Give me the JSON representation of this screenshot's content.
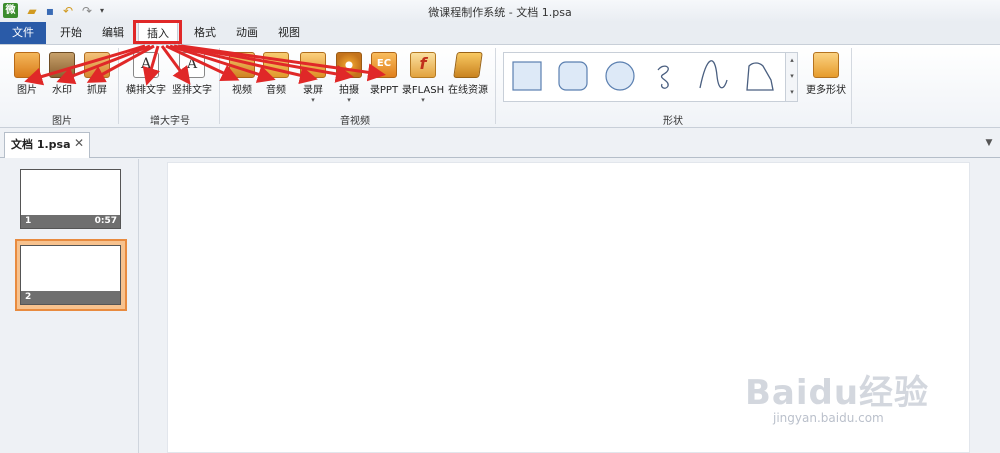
{
  "window": {
    "title": "微课程制作系统 - 文档 1.psa",
    "app_logo_glyph": "微",
    "quick_access": [
      "open-icon",
      "save-icon",
      "undo-icon",
      "redo-icon",
      "customize-icon"
    ]
  },
  "menu_tabs": [
    {
      "label": "文件",
      "active": false
    },
    {
      "label": "开始",
      "active": false
    },
    {
      "label": "编辑",
      "active": false
    },
    {
      "label": "插入",
      "active": true
    },
    {
      "label": "格式",
      "active": false
    },
    {
      "label": "动画",
      "active": false
    },
    {
      "label": "视图",
      "active": false
    }
  ],
  "ribbon": {
    "groups": [
      {
        "label": "图片",
        "buttons": [
          "图片",
          "水印",
          "抓屏"
        ]
      },
      {
        "label": "增大字号",
        "buttons": [
          "横排文字",
          "竖排文字"
        ]
      },
      {
        "label": "音视频",
        "buttons": [
          "视频",
          "音频",
          "录屏",
          "拍摄",
          "录PPT",
          "录FLASH",
          "在线资源"
        ]
      },
      {
        "label": "形状",
        "buttons": [
          "更多形状"
        ]
      }
    ],
    "txt_icon_glyph": "A",
    "ppt_icon_glyph": "EC",
    "flash_icon_glyph": "f",
    "dropdown_glyph": "▾",
    "gallery_scroll": [
      "▴",
      "▾",
      "▾"
    ]
  },
  "document_tab": {
    "label": "文档 1.psa",
    "close": "✕"
  },
  "strip_menu_glyph": "▼",
  "slides": [
    {
      "number": "1",
      "duration": "0:57",
      "selected": false
    },
    {
      "number": "2",
      "duration": "",
      "selected": true
    }
  ],
  "watermark": {
    "brand": "Baidu经验",
    "sub": "jingyan.baidu.com"
  },
  "colors": {
    "file_tab": "#2a5ba8",
    "highlight": "#e02828",
    "selected_slide": "#e88b3f"
  }
}
